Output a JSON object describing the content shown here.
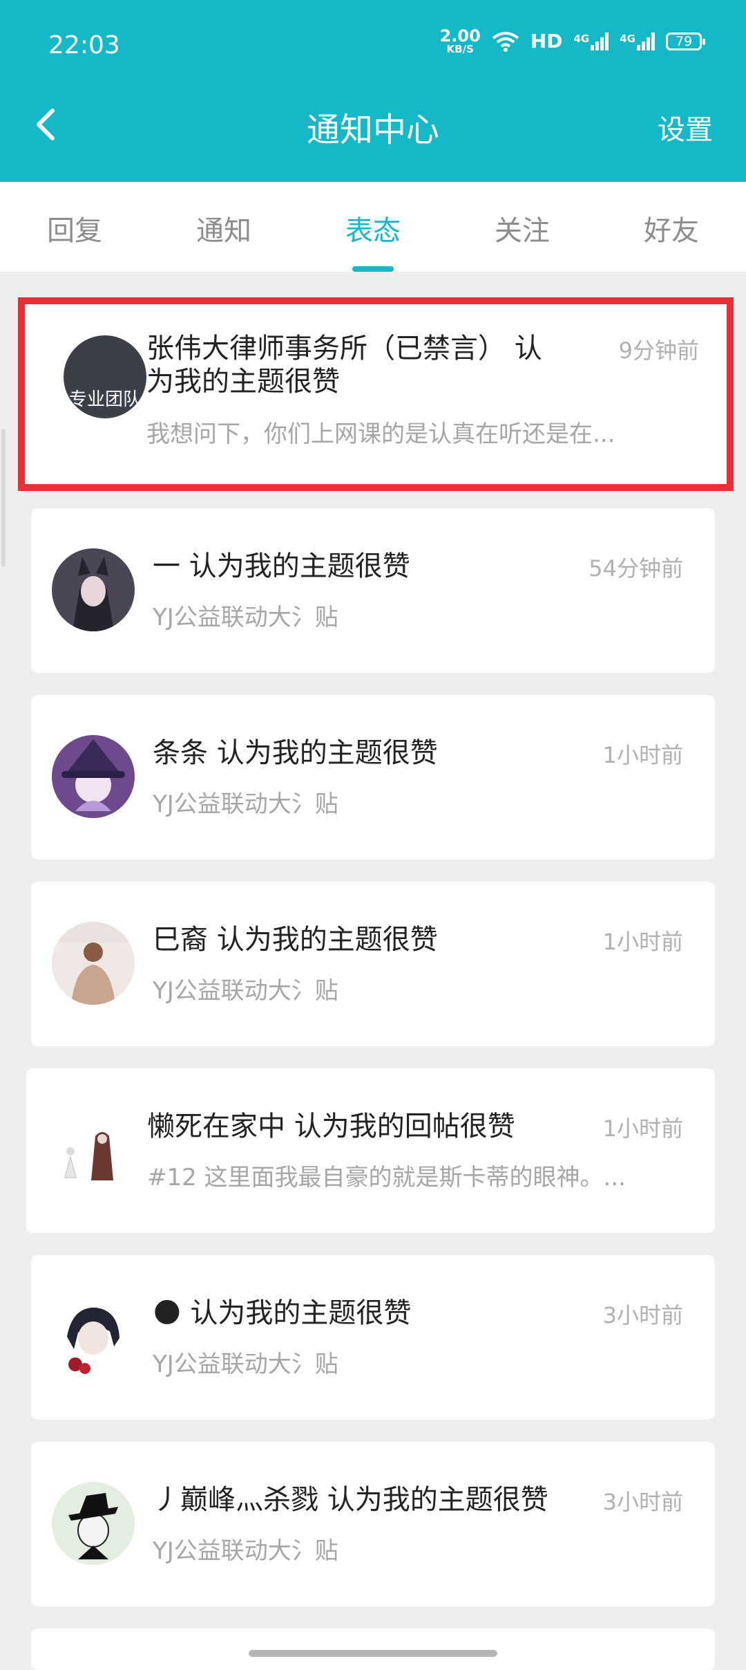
{
  "status_bar": {
    "time": "22:03",
    "net_speed": "2.00",
    "net_unit": "KB/S",
    "hd": "HD",
    "sig1": "4G",
    "sig2": "4G",
    "battery": "79"
  },
  "header": {
    "title": "通知中心",
    "settings_label": "设置"
  },
  "tabs": [
    {
      "label": "回复",
      "active": false
    },
    {
      "label": "通知",
      "active": false
    },
    {
      "label": "表态",
      "active": true
    },
    {
      "label": "关注",
      "active": false
    },
    {
      "label": "好友",
      "active": false
    }
  ],
  "items": [
    {
      "title": "张伟大律师事务所（已禁言） 认为我的主题很赞",
      "subtitle": "我想问下，你们上网课的是认真在听还是在...",
      "time": "9分钟前",
      "avatar_text": "专业团队",
      "avatar_color": "#3b3f48",
      "highlighted": true
    },
    {
      "title": "一 认为我的主题很赞",
      "subtitle": "YJ公益联动大氵贴",
      "time": "54分钟前",
      "avatar_color": "#4a4656",
      "highlighted": false
    },
    {
      "title": "条条 认为我的主题很赞",
      "subtitle": "YJ公益联动大氵贴",
      "time": "1小时前",
      "avatar_color": "#6c4a8c",
      "highlighted": false
    },
    {
      "title": "巳裔 认为我的主题很赞",
      "subtitle": "YJ公益联动大氵贴",
      "time": "1小时前",
      "avatar_color": "#c9a58f",
      "highlighted": false
    },
    {
      "title": "懒死在家中 认为我的回帖很赞",
      "subtitle": "#12 这里面我最自豪的就是斯卡蒂的眼神。...",
      "time": "1小时前",
      "avatar_color": "#f3efec",
      "highlighted": false
    },
    {
      "title": "🌑 认为我的主题很赞",
      "subtitle": "YJ公益联动大氵贴",
      "time": "3小时前",
      "avatar_color": "#2d2f3c",
      "highlighted": false
    },
    {
      "title": "丿巅峰灬杀戮 认为我的主题很赞",
      "subtitle": "YJ公益联动大氵贴",
      "time": "3小时前",
      "avatar_color": "#e4eee0",
      "highlighted": false
    }
  ],
  "colors": {
    "accent": "#15b8c7",
    "highlight_border": "#ea2f37",
    "background": "#eeeeee"
  }
}
